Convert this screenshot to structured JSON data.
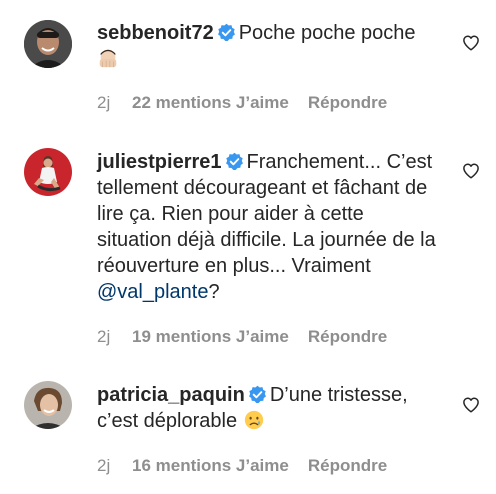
{
  "comments": [
    {
      "username": "sebbenoit72",
      "text": "Poche poche poche",
      "time": "2j",
      "likes": "22 mentions J’aime",
      "reply": "Répondre",
      "emoji": "facepalm-man-emoji"
    },
    {
      "username": "juliestpierre1",
      "text": "Franchement... C’est tellement décourageant et fâchant de lire ça. Rien pour aider à cette situation déjà difficile. La journée de la réouverture en plus... Vraiment ",
      "mention": "@val_plante",
      "text_after": "?",
      "time": "2j",
      "likes": "19 mentions J’aime",
      "reply": "Répondre"
    },
    {
      "username": "patricia_paquin",
      "text": "D’une tristesse, c’est déplorable ",
      "emoji": "crying-face-emoji",
      "time": "2j",
      "likes": "16 mentions J’aime",
      "reply": "Répondre"
    }
  ],
  "colors": {
    "verified": "#3897f0",
    "mention": "#00376b",
    "meta": "#8e8e8e"
  }
}
